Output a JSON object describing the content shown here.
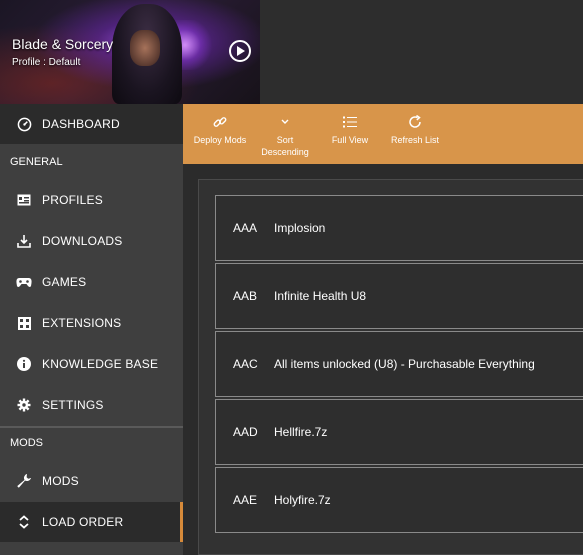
{
  "game": {
    "title": "Blade & Sorcery",
    "profile": "Profile : Default"
  },
  "sidebar": {
    "dashboard_label": "DASHBOARD",
    "sections": [
      {
        "title": "GENERAL",
        "items": [
          {
            "label": "PROFILES",
            "icon": "profiles-icon"
          },
          {
            "label": "DOWNLOADS",
            "icon": "download-icon"
          },
          {
            "label": "GAMES",
            "icon": "gamepad-icon"
          },
          {
            "label": "EXTENSIONS",
            "icon": "extensions-icon"
          },
          {
            "label": "KNOWLEDGE BASE",
            "icon": "info-icon"
          },
          {
            "label": "SETTINGS",
            "icon": "gear-icon"
          }
        ]
      },
      {
        "title": "MODS",
        "items": [
          {
            "label": "MODS",
            "icon": "wrench-icon"
          },
          {
            "label": "LOAD ORDER",
            "icon": "sort-icon",
            "active": true
          }
        ]
      }
    ]
  },
  "toolbar": {
    "deploy": "Deploy Mods",
    "sort_line1": "Sort",
    "sort_line2": "Descending",
    "full_view": "Full View",
    "refresh": "Refresh List"
  },
  "load_order": [
    {
      "code": "AAA",
      "name": "Implosion"
    },
    {
      "code": "AAB",
      "name": "Infinite Health U8"
    },
    {
      "code": "AAC",
      "name": "All items unlocked (U8) - Purchasable Everything"
    },
    {
      "code": "AAD",
      "name": "Hellfire.7z"
    },
    {
      "code": "AAE",
      "name": "Holyfire.7z"
    }
  ],
  "colors": {
    "accent": "#d8954a",
    "sidebar_bg": "#3f3f3f",
    "content_bg": "#2b2b2b",
    "active_indicator": "#d68a3a"
  }
}
